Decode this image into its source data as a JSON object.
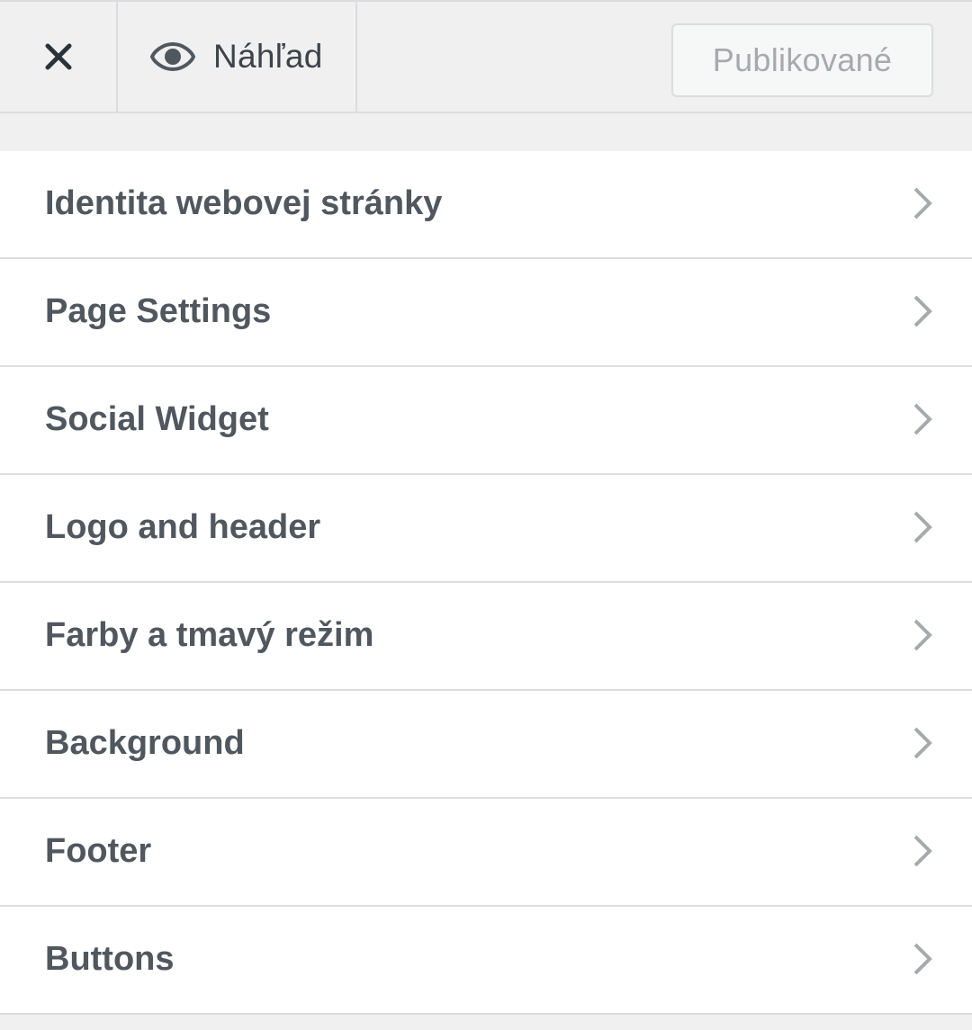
{
  "toolbar": {
    "close_icon": "close-icon",
    "preview_icon": "eye-icon",
    "preview_label": "Náhľad",
    "publish_label": "Publikované"
  },
  "panels": [
    {
      "title": "Identita webovej stránky",
      "icon": "chevron-right-icon"
    },
    {
      "title": "Page Settings",
      "icon": "chevron-right-icon"
    },
    {
      "title": "Social Widget",
      "icon": "chevron-right-icon"
    },
    {
      "title": "Logo and header",
      "icon": "chevron-right-icon"
    },
    {
      "title": "Farby a tmavý režim",
      "icon": "chevron-right-icon"
    },
    {
      "title": "Background",
      "icon": "chevron-right-icon"
    },
    {
      "title": "Footer",
      "icon": "chevron-right-icon"
    },
    {
      "title": "Buttons",
      "icon": "chevron-right-icon"
    }
  ],
  "colors": {
    "toolbar_bg": "#f0f0f1",
    "panel_bg": "#ffffff",
    "text": "#50575e",
    "muted": "#a7aaad",
    "border": "#dcdcde"
  }
}
